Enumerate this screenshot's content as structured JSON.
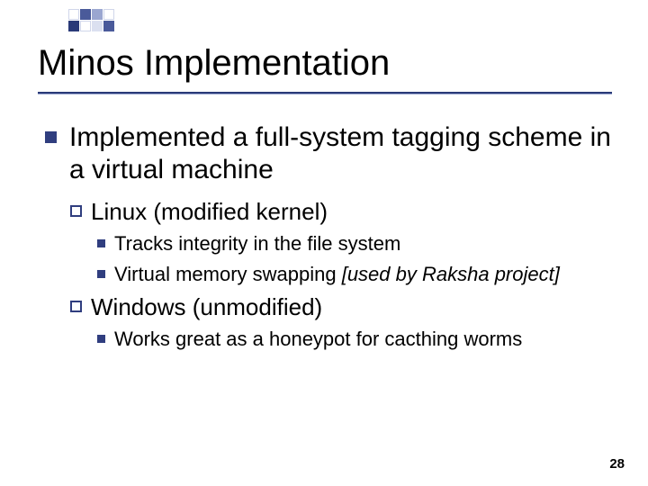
{
  "slide": {
    "title": "Minos Implementation",
    "page_number": "28",
    "bullets": {
      "l1_text": "Implemented a full-system tagging scheme in a virtual machine",
      "linux": {
        "label": "Linux (modified kernel)",
        "i1": "Tracks integrity in the file system",
        "i2_a": "Virtual memory swapping ",
        "i2_b": "[used by Raksha project]"
      },
      "windows": {
        "label": "Windows (unmodified)",
        "i1": "Works great as a honeypot for cacthing worms"
      }
    }
  }
}
